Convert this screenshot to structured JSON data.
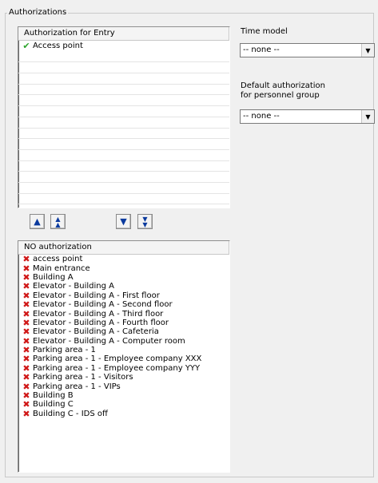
{
  "group_title": "Authorizations",
  "authorization_list": {
    "header": "Authorization for Entry",
    "items": [
      "Access point"
    ]
  },
  "time_model": {
    "label": "Time model",
    "value": "-- none --"
  },
  "default_authorization": {
    "label_line1": "Default authorization",
    "label_line2": "for personnel group",
    "value": "-- none --"
  },
  "buttons": {
    "move_up": "up-arrow-icon",
    "move_top": "double-up-arrow-icon",
    "move_down": "down-arrow-icon",
    "move_bottom": "double-down-arrow-icon"
  },
  "no_authorization_list": {
    "header": "NO authorization",
    "items": [
      "access point",
      "Main entrance",
      "Building A",
      "Elevator - Building A",
      "Elevator - Building A - First floor",
      "Elevator - Building A - Second floor",
      "Elevator - Building A - Third floor",
      "Elevator - Building A - Fourth floor",
      "Elevator - Building A - Cafeteria",
      "Elevator - Building A - Computer room",
      "Parking area - 1",
      "Parking area - 1 - Employee company XXX",
      "Parking area - 1 - Employee company YYY",
      "Parking area - 1 - Visitors",
      "Parking area - 1 - VIPs",
      "Building B",
      "Building C",
      "Building C - IDS off"
    ]
  },
  "colors": {
    "check": "#2ba52b",
    "cross": "#d01818",
    "arrow": "#0b3a9e"
  }
}
